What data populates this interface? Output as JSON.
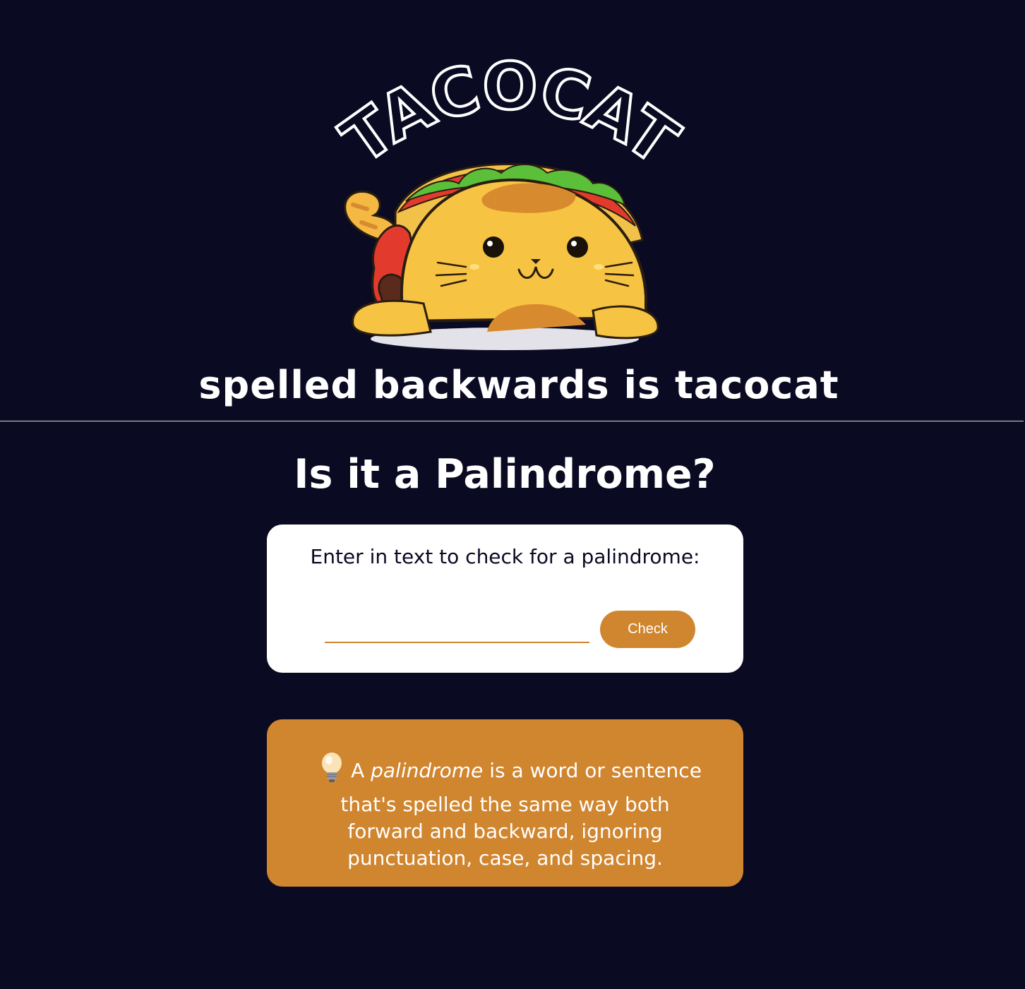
{
  "hero": {
    "logo_text": "TACOCAT",
    "tagline": "spelled backwards is tacocat"
  },
  "main": {
    "title": "Is it a Palindrome?"
  },
  "checker": {
    "label": "Enter in text to check for a palindrome:",
    "input_value": "",
    "input_placeholder": "",
    "button_label": "Check"
  },
  "info": {
    "icon": "lightbulb-icon",
    "lead": "A",
    "term": "palindrome",
    "line1_rest": "is a word or sentence",
    "line2": "that's spelled the same way both",
    "line3": "forward and backward, ignoring",
    "line4": "punctuation, case, and spacing."
  },
  "colors": {
    "background": "#0a0a23",
    "accent": "#d0852f",
    "card": "#ffffff"
  }
}
